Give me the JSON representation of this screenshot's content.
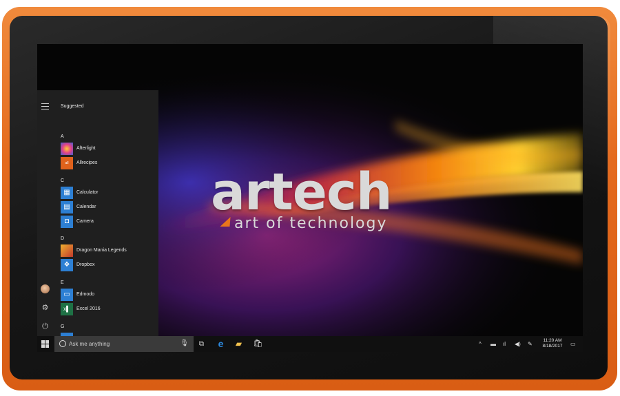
{
  "device": {
    "frame_color": "#e8701f"
  },
  "wallpaper": {
    "logo_text": "artech",
    "tagline": "art of technology"
  },
  "start_menu": {
    "header": "Suggested",
    "sections": [
      {
        "letter": "A",
        "apps": [
          {
            "label": "Afterlight",
            "icon": "afterlight-icon",
            "color": "#6b3fa0"
          },
          {
            "label": "Allrecipes",
            "icon": "allrecipes-icon",
            "color": "#e0621c"
          }
        ]
      },
      {
        "letter": "C",
        "apps": [
          {
            "label": "Calculator",
            "icon": "calculator-icon",
            "color": "#2d7fd3"
          },
          {
            "label": "Calendar",
            "icon": "calendar-icon",
            "color": "#2d7fd3"
          },
          {
            "label": "Camera",
            "icon": "camera-icon",
            "color": "#2d7fd3"
          }
        ]
      },
      {
        "letter": "D",
        "apps": [
          {
            "label": "Dragon Mania Legends",
            "icon": "dragon-mania-legends-icon",
            "color": "#c0392b"
          },
          {
            "label": "Dropbox",
            "icon": "dropbox-icon",
            "color": "#2d7fd3"
          }
        ]
      },
      {
        "letter": "E",
        "apps": [
          {
            "label": "Edmodo",
            "icon": "edmodo-icon",
            "color": "#2d7fd3"
          },
          {
            "label": "Excel 2016",
            "icon": "excel-icon",
            "color": "#1e7145"
          }
        ]
      },
      {
        "letter": "G",
        "apps": []
      }
    ]
  },
  "taskbar": {
    "search_placeholder": "Ask me anything",
    "clock_time": "11:20 AM",
    "clock_date": "8/18/2017",
    "accent_color": "#2d7fd3"
  }
}
